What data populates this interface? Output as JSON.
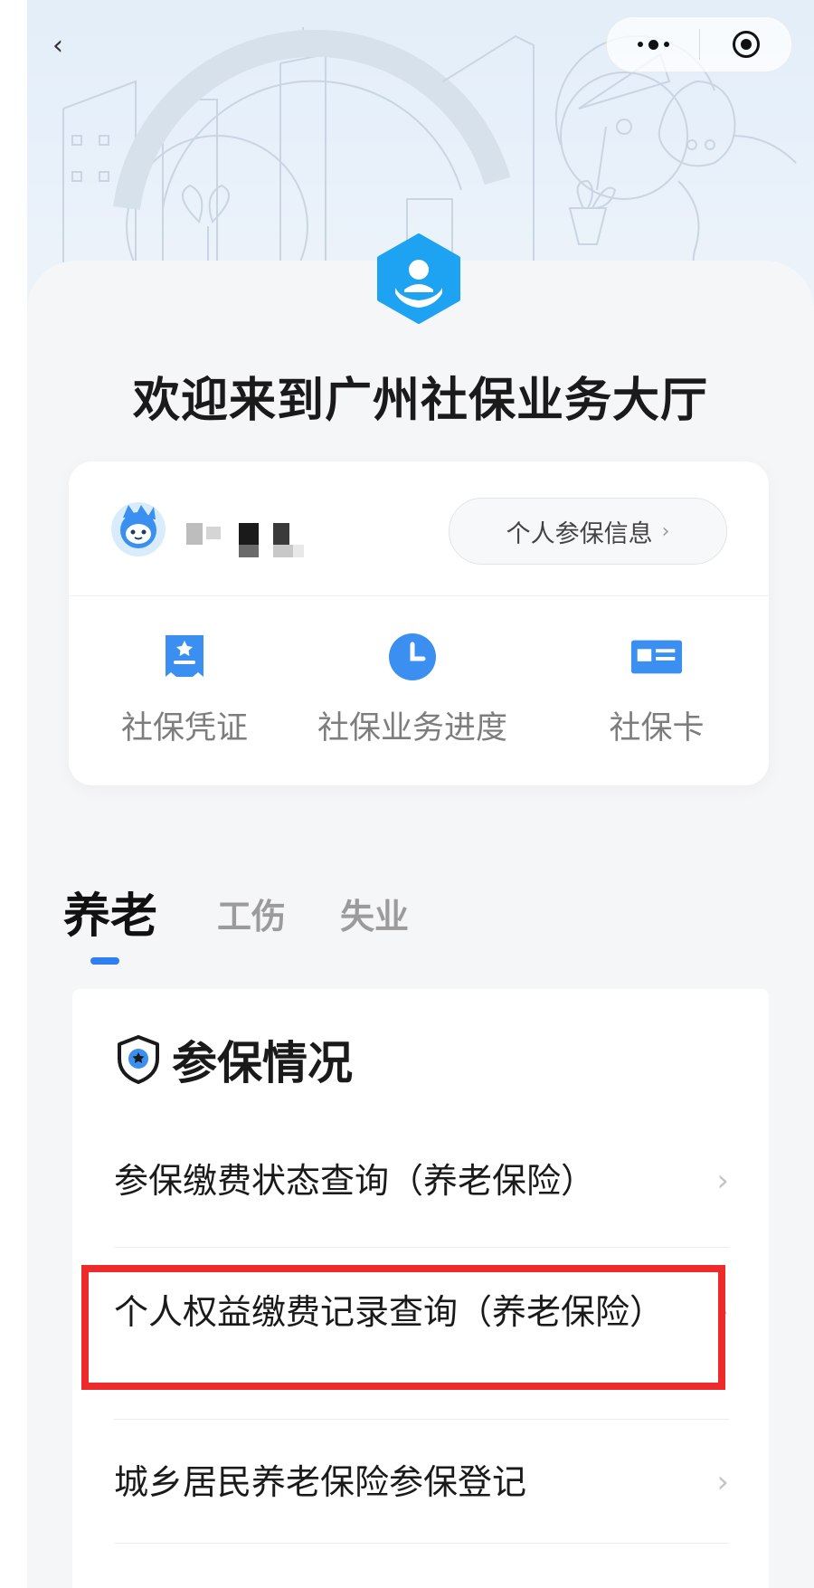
{
  "nav": {
    "back_glyph": "‹",
    "more_icon": "more-dots-icon",
    "close_icon": "target-circle-icon"
  },
  "header": {
    "title": "欢迎来到广州社保业务大厅"
  },
  "profile": {
    "name_masked": true,
    "info_button_label": "个人参保信息",
    "info_button_chevron": "›"
  },
  "quick_actions": [
    {
      "label": "社保凭证",
      "icon": "certificate-icon"
    },
    {
      "label": "社保业务进度",
      "icon": "clock-icon"
    },
    {
      "label": "社保卡",
      "icon": "id-card-icon"
    }
  ],
  "tabs": [
    {
      "label": "养老",
      "active": true
    },
    {
      "label": "工伤",
      "active": false
    },
    {
      "label": "失业",
      "active": false
    }
  ],
  "section": {
    "title": "参保情况",
    "items": [
      {
        "label": "参保缴费状态查询（养老保险）"
      },
      {
        "label": "个人权益缴费记录查询（养老保险）",
        "highlighted": true
      },
      {
        "label": "城乡居民养老保险参保登记"
      }
    ],
    "arrow_glyph": "›"
  },
  "colors": {
    "accent": "#2f7ff2",
    "logo_blue": "#1ea2f2",
    "highlight_red": "#ee2a2a",
    "hero_bg": "#e5eff9",
    "page_bg": "#f5f6f8"
  }
}
